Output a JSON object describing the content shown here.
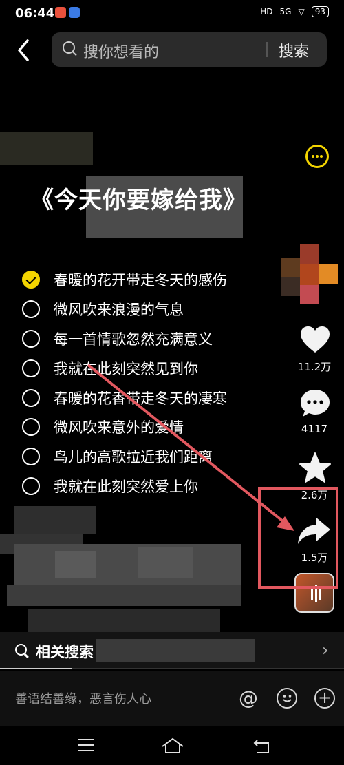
{
  "status_bar": {
    "time": "06:44",
    "network_badge": "HD",
    "signal_label": "5G",
    "battery": "93"
  },
  "search": {
    "back_icon": "chevron-left-icon",
    "placeholder": "搜你想看的",
    "button_label": "搜索"
  },
  "video": {
    "title": "《今天你要嫁给我》",
    "lyrics": [
      {
        "text": "春暖的花开带走冬天的感伤",
        "checked": true
      },
      {
        "text": "微风吹来浪漫的气息",
        "checked": false
      },
      {
        "text": "每一首情歌忽然充满意义",
        "checked": false
      },
      {
        "text": "我就在此刻突然见到你",
        "checked": false
      },
      {
        "text": "春暖的花香带走冬天的凄寒",
        "checked": false
      },
      {
        "text": "微风吹来意外的爱情",
        "checked": false
      },
      {
        "text": "鸟儿的高歌拉近我们距离",
        "checked": false
      },
      {
        "text": "我就在此刻突然爱上你",
        "checked": false
      }
    ]
  },
  "actions": {
    "like_count": "11.2万",
    "comment_count": "4117",
    "favorite_count": "2.6万",
    "share_count": "1.5万"
  },
  "related": {
    "label": "相关搜索"
  },
  "comment_bar": {
    "placeholder": "善语结善缘，恶言伤人心",
    "mention_symbol": "@",
    "plus_symbol": "+"
  },
  "colors": {
    "accent": "#f3d400",
    "annotation": "#e2585f"
  }
}
